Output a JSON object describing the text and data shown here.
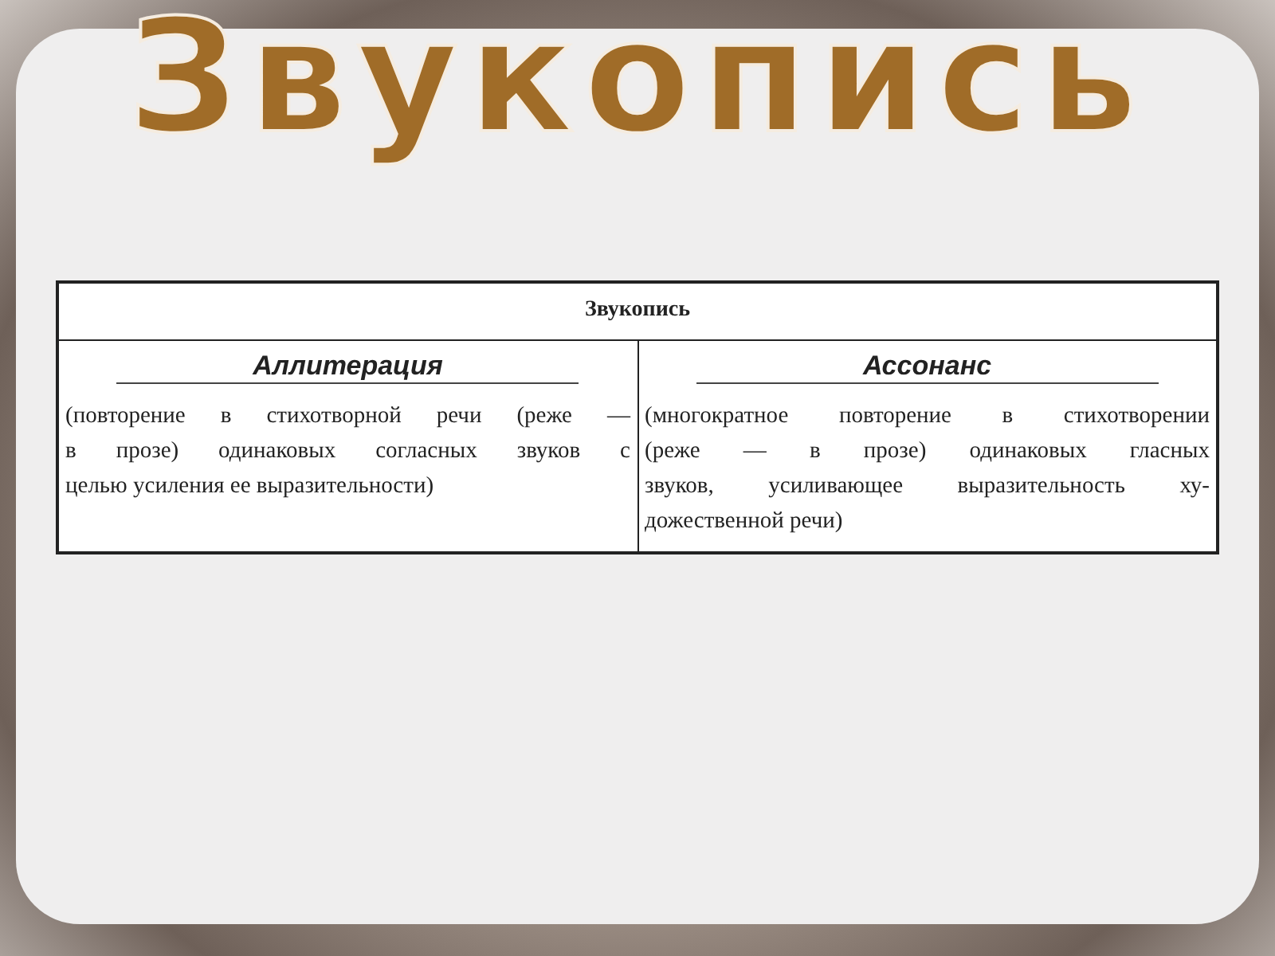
{
  "slide_title": "Звукопись",
  "table": {
    "caption": "Звукопись",
    "columns": [
      {
        "heading": "Аллитерация",
        "definition_lines": [
          "(повторение в стихотворной речи (реже —",
          "в прозе) одинаковых согласных звуков с",
          "целью усиления ее выразительности)"
        ]
      },
      {
        "heading": "Ассонанс",
        "definition_lines": [
          "(многократное повторение в стихотворении",
          "(реже — в прозе) одинаковых гласных",
          "звуков, усиливающее выразительность ху-",
          "дожественной речи)"
        ]
      }
    ]
  }
}
